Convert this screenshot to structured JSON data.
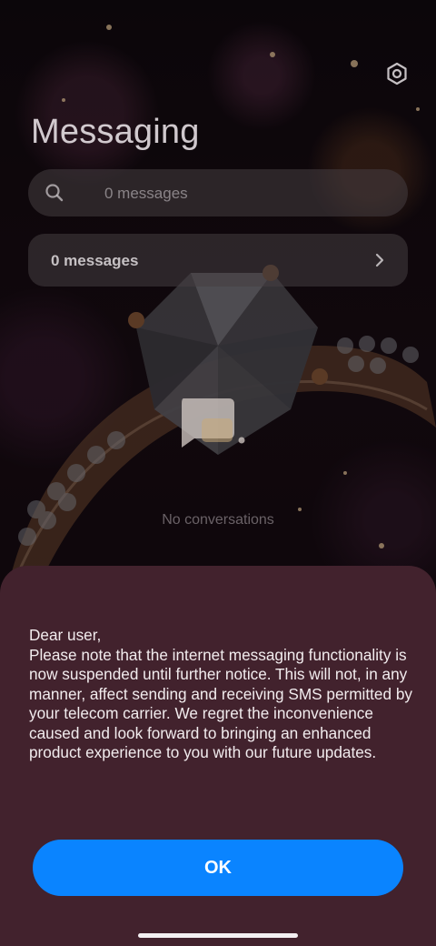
{
  "app": {
    "title": "Messaging"
  },
  "header": {
    "settings_icon": "gear-icon"
  },
  "search": {
    "placeholder": "0 messages",
    "icon": "search-icon"
  },
  "message_summary": {
    "label": "0 messages",
    "icon": "chevron-right-icon"
  },
  "empty_state": {
    "icon": "chat-bubble-icon",
    "label": "No conversations"
  },
  "notice_sheet": {
    "greeting": "Dear user,",
    "body": "Please note that the internet messaging functionality is now suspended until further notice. This will not, in any manner, affect sending and receiving SMS permitted by your telecom carrier. We regret the inconvenience caused and look forward to bringing an enhanced product experience to you with our future updates.",
    "ok_label": "OK"
  },
  "colors": {
    "sheet_background": "#42222d",
    "primary_button": "#0a84ff",
    "button_text": "#ffffff"
  }
}
